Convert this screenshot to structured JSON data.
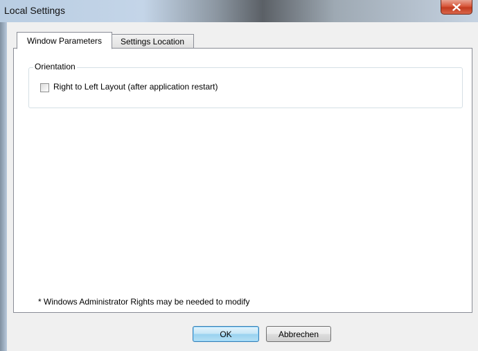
{
  "window": {
    "title": "Local Settings"
  },
  "tabs": [
    {
      "label": "Window Parameters",
      "active": true
    },
    {
      "label": "Settings Location",
      "active": false
    }
  ],
  "orientation_group": {
    "label": "Orientation",
    "checkbox_label": "Right to Left Layout (after application restart)",
    "checked": false
  },
  "note": "* Windows Administrator Rights may be needed to modify",
  "buttons": {
    "ok": "OK",
    "cancel": "Abbrechen"
  },
  "icons": {
    "close": "close-icon"
  },
  "colors": {
    "close_button": "#c23b1f",
    "ok_button_border": "#3c7fb1"
  }
}
